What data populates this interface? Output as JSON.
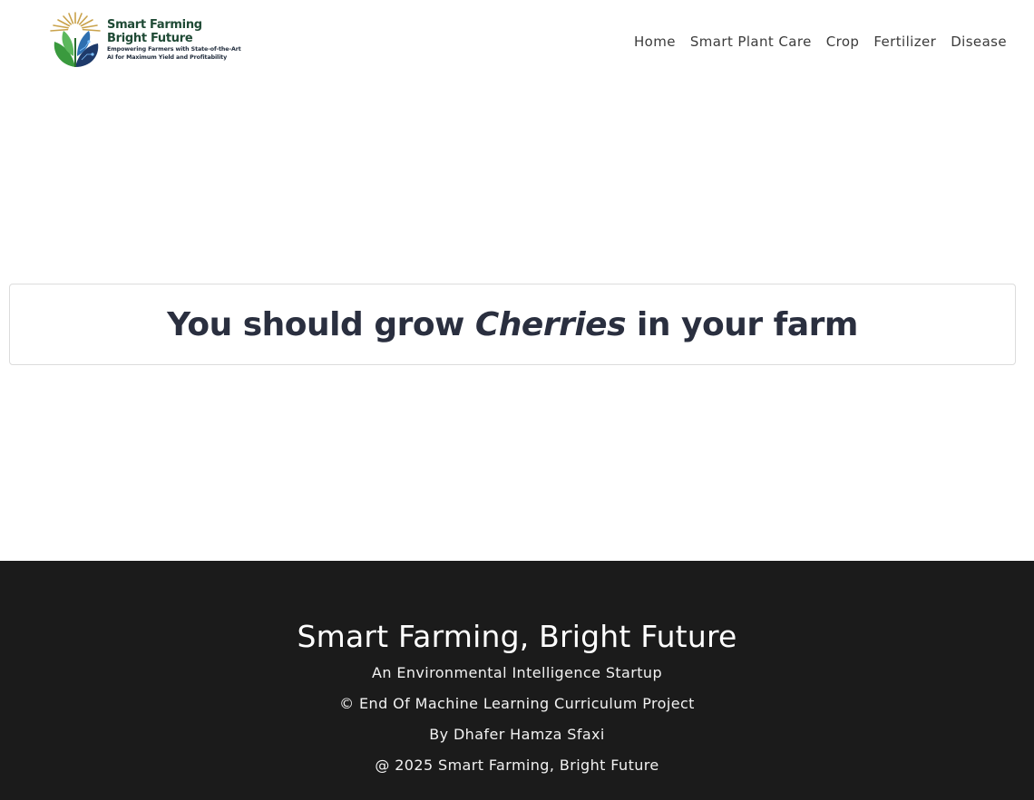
{
  "brand": {
    "title_line1": "Smart Farming",
    "title_line2": "Bright Future",
    "tagline_line1": "Empowering Farmers with State-of-the-Art",
    "tagline_line2": "AI for Maximum Yield and Profitability",
    "colors": {
      "green": "#2f8a3b",
      "dark_green": "#1f4a35",
      "navy": "#1e3a6a",
      "gold": "#c9a24a"
    }
  },
  "nav": {
    "items": [
      {
        "label": "Home"
      },
      {
        "label": "Smart Plant Care"
      },
      {
        "label": "Crop"
      },
      {
        "label": "Fertilizer"
      },
      {
        "label": "Disease"
      }
    ]
  },
  "result": {
    "prefix": "You should grow ",
    "crop": "Cherries",
    "suffix": " in your farm"
  },
  "footer": {
    "title": "Smart Farming, Bright Future",
    "subtitle": "An Environmental Intelligence Startup",
    "project": "© End Of Machine Learning Curriculum Project",
    "author": "By Dhafer Hamza Sfaxi",
    "copyright": "@ 2025 Smart Farming, Bright Future",
    "background": "#1b1b1b"
  }
}
